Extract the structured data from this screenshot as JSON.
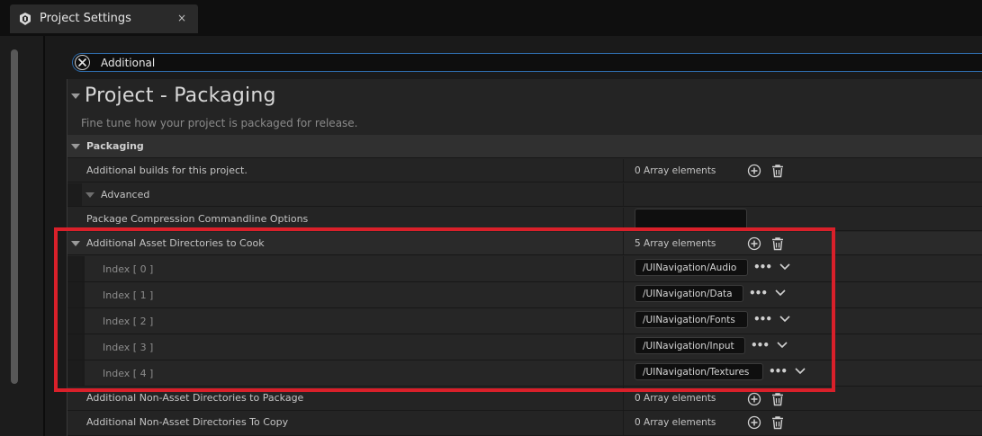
{
  "tab": {
    "title": "Project Settings",
    "close": "×",
    "icon": "unreal-logo-icon"
  },
  "search": {
    "value": "Additional",
    "clear_icon": "close-circle-icon"
  },
  "section": {
    "title": "Project - Packaging",
    "description": "Fine tune how your project is packaged for release."
  },
  "category": {
    "label": "Packaging"
  },
  "rows": {
    "builds": {
      "label": "Additional builds for this project.",
      "value": "0 Array elements"
    },
    "advanced": {
      "label": "Advanced"
    },
    "compression": {
      "label": "Package Compression Commandline Options"
    },
    "cook": {
      "label": "Additional Asset Directories to Cook",
      "value": "5 Array elements"
    },
    "non_asset_package": {
      "label": "Additional Non-Asset Directories to Package",
      "value": "0 Array elements"
    },
    "non_asset_copy": {
      "label": "Additional Non-Asset Directories To Copy",
      "value": "0 Array elements"
    }
  },
  "cook_items": [
    {
      "index": "Index [ 0 ]",
      "path": "/UINavigation/Audio"
    },
    {
      "index": "Index [ 1 ]",
      "path": "/UINavigation/Data"
    },
    {
      "index": "Index [ 2 ]",
      "path": "/UINavigation/Fonts"
    },
    {
      "index": "Index [ 3 ]",
      "path": "/UINavigation/Input"
    },
    {
      "index": "Index [ 4 ]",
      "path": "/UINavigation/Textures"
    }
  ],
  "browse_label": "•••",
  "colors": {
    "highlight": "#d9202a",
    "search_border": "#2e6aa8"
  }
}
